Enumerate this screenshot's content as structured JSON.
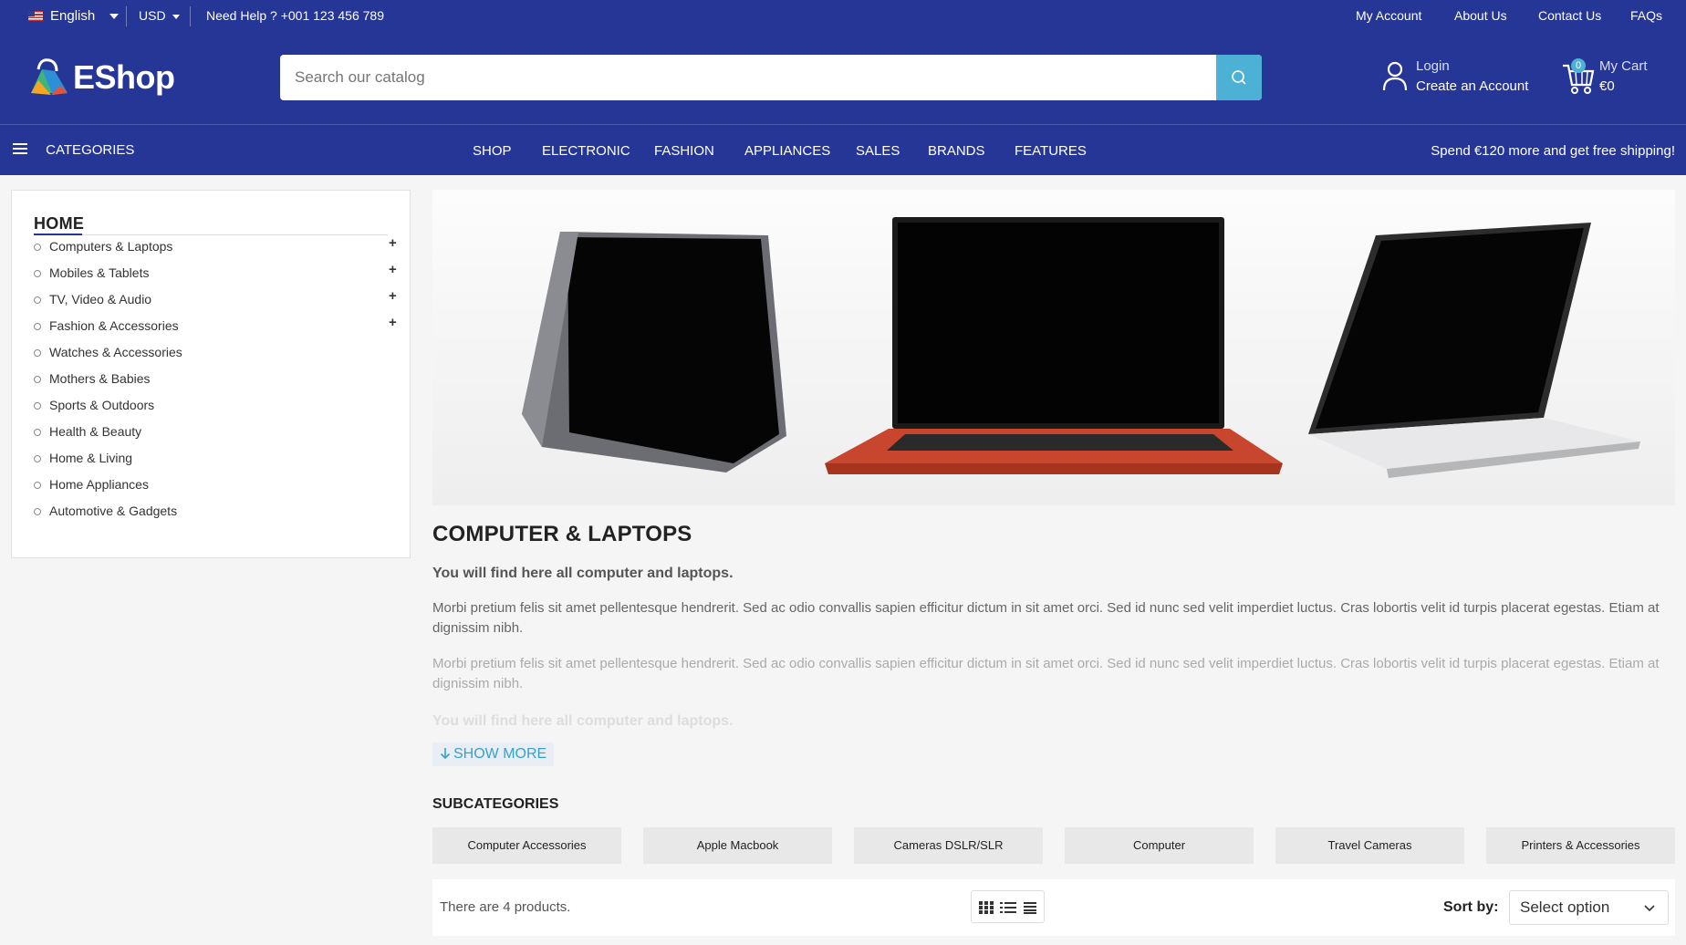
{
  "topbar": {
    "language": "English",
    "currency": "USD",
    "help": "Need Help ? +001 123 456 789",
    "links": [
      "My Account",
      "About Us",
      "Contact Us",
      "FAQs"
    ]
  },
  "header": {
    "logo_text": "EShop",
    "search_placeholder": "Search our catalog",
    "login": "Login",
    "create_account": "Create an Account",
    "cart_label": "My Cart",
    "cart_total": "€0",
    "cart_count": "0"
  },
  "nav": {
    "categories": "CATEGORIES",
    "items": [
      "SHOP",
      "ELECTRONIC",
      "FASHION",
      "APPLIANCES",
      "SALES",
      "BRANDS",
      "FEATURES"
    ],
    "promo": "Spend €120 more and get free shipping!"
  },
  "sidebar": {
    "title": "HOME",
    "items": [
      {
        "label": "Computers & Laptops",
        "expandable": true
      },
      {
        "label": "Mobiles & Tablets",
        "expandable": true
      },
      {
        "label": "TV, Video & Audio",
        "expandable": true
      },
      {
        "label": "Fashion & Accessories",
        "expandable": true
      },
      {
        "label": "Watches & Accessories",
        "expandable": false
      },
      {
        "label": "Mothers & Babies",
        "expandable": false
      },
      {
        "label": "Sports & Outdoors",
        "expandable": false
      },
      {
        "label": "Health & Beauty",
        "expandable": false
      },
      {
        "label": "Home & Living",
        "expandable": false
      },
      {
        "label": "Home Appliances",
        "expandable": false
      },
      {
        "label": "Automotive & Gadgets",
        "expandable": false
      }
    ],
    "expand_symbol": "+"
  },
  "category": {
    "title": "COMPUTER & LAPTOPS",
    "subtitle": "You will find here all computer and laptops.",
    "paragraph_1": "Morbi pretium felis sit amet pellentesque hendrerit. Sed ac odio convallis sapien efficitur dictum in sit amet orci. Sed id nunc sed velit imperdiet luctus. Cras lobortis velit id turpis placerat egestas. Etiam at dignissim nibh.",
    "paragraph_2": "Morbi pretium felis sit amet pellentesque hendrerit. Sed ac odio convallis sapien efficitur dictum in sit amet orci. Sed id nunc sed velit imperdiet luctus. Cras lobortis velit id turpis placerat egestas. Etiam at dignissim nibh.",
    "faded_line": "You will find here all computer and laptops.",
    "show_more": "SHOW MORE"
  },
  "subcategories": {
    "title": "SUBCATEGORIES",
    "items": [
      "Computer Accessories",
      "Apple Macbook",
      "Cameras DSLR/SLR",
      "Computer",
      "Travel Cameras",
      "Printers & Accessories"
    ]
  },
  "toolbar": {
    "count": "There are 4 products.",
    "sort_label": "Sort by:",
    "sort_value": "Select option"
  },
  "colors": {
    "brand_blue": "#263697",
    "accent_cyan": "#4db1d6"
  }
}
